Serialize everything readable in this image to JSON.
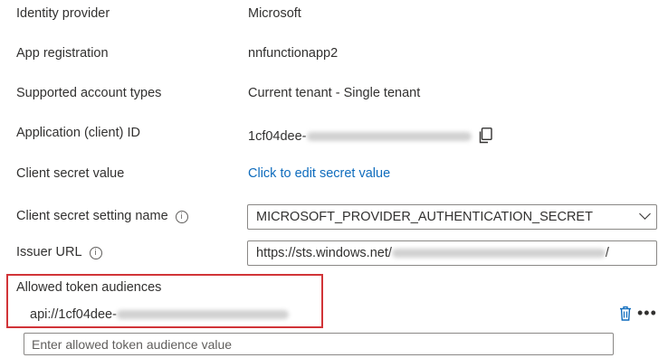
{
  "rows": {
    "identity_provider": {
      "label": "Identity provider",
      "value": "Microsoft"
    },
    "app_registration": {
      "label": "App registration",
      "value": "nnfunctionapp2"
    },
    "supported_account_types": {
      "label": "Supported account types",
      "value": "Current tenant - Single tenant"
    },
    "client_id": {
      "label": "Application (client) ID",
      "value_prefix": "1cf04dee-"
    },
    "client_secret_value": {
      "label": "Client secret value",
      "link": "Click to edit secret value"
    },
    "client_secret_setting_name": {
      "label": "Client secret setting name",
      "selected": "MICROSOFT_PROVIDER_AUTHENTICATION_SECRET"
    },
    "issuer_url": {
      "label": "Issuer URL",
      "value_prefix": "https://sts.windows.net/",
      "value_suffix": "/"
    }
  },
  "audiences": {
    "label": "Allowed token audiences",
    "item_prefix": "api://1cf04dee-",
    "placeholder": "Enter allowed token audience value"
  },
  "icons": {
    "info": "info-icon",
    "copy": "copy-icon",
    "chevron": "chevron-down-icon",
    "trash": "trash-icon",
    "more": "more-icon"
  },
  "colors": {
    "link": "#0f6cbd",
    "highlight_border": "#d13438",
    "trash": "#0f6cbd"
  }
}
